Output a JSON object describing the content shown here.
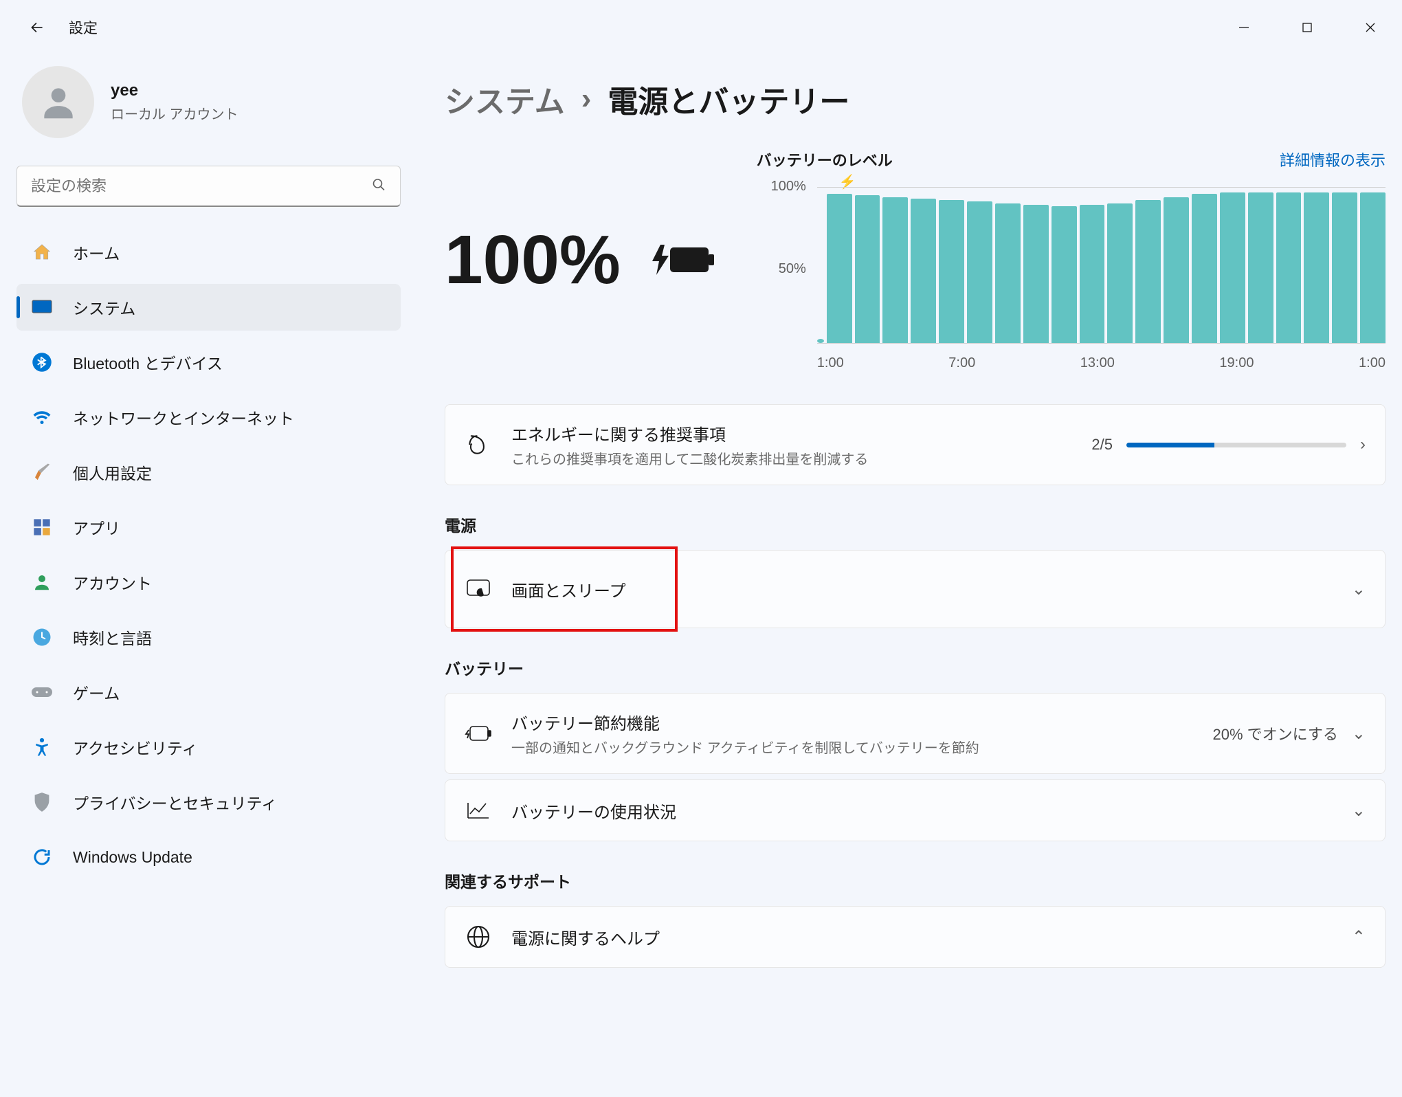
{
  "window_title": "設定",
  "profile": {
    "name": "yee",
    "sub": "ローカル アカウント"
  },
  "search": {
    "placeholder": "設定の検索"
  },
  "sidebar": {
    "items": [
      {
        "label": "ホーム"
      },
      {
        "label": "システム"
      },
      {
        "label": "Bluetooth とデバイス"
      },
      {
        "label": "ネットワークとインターネット"
      },
      {
        "label": "個人用設定"
      },
      {
        "label": "アプリ"
      },
      {
        "label": "アカウント"
      },
      {
        "label": "時刻と言語"
      },
      {
        "label": "ゲーム"
      },
      {
        "label": "アクセシビリティ"
      },
      {
        "label": "プライバシーとセキュリティ"
      },
      {
        "label": "Windows Update"
      }
    ]
  },
  "breadcrumb": {
    "parent": "システム",
    "current": "電源とバッテリー"
  },
  "battery": {
    "percent_label": "100%",
    "chart_title": "バッテリーのレベル",
    "details_link": "詳細情報の表示",
    "y_100": "100%",
    "y_50": "50%"
  },
  "chart_data": {
    "type": "bar",
    "categories": [
      "1:00",
      "7:00",
      "13:00",
      "19:00",
      "1:00"
    ],
    "values": [
      97,
      96,
      95,
      94,
      93,
      92,
      91,
      90,
      89,
      88,
      89,
      90,
      92,
      94,
      96,
      97,
      97,
      97,
      97,
      97,
      97
    ],
    "title": "バッテリーのレベル",
    "xlabel": "",
    "ylabel": "",
    "ylim": [
      0,
      100
    ]
  },
  "energy_card": {
    "title": "エネルギーに関する推奨事項",
    "sub": "これらの推奨事項を適用して二酸化炭素排出量を削減する",
    "ratio": "2/5",
    "progress": 40
  },
  "sections": {
    "power": "電源",
    "battery": "バッテリー",
    "support": "関連するサポート"
  },
  "screen_sleep": {
    "title": "画面とスリープ"
  },
  "battery_saver": {
    "title": "バッテリー節約機能",
    "sub": "一部の通知とバックグラウンド アクティビティを制限してバッテリーを節約",
    "aux": "20% でオンにする"
  },
  "battery_usage": {
    "title": "バッテリーの使用状況"
  },
  "power_help": {
    "title": "電源に関するヘルプ"
  }
}
